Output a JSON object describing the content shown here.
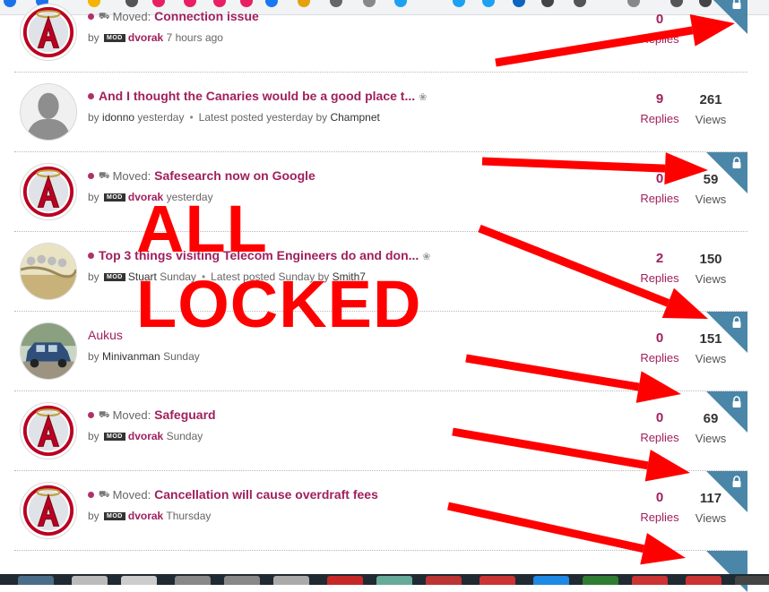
{
  "colors": {
    "accent": "#a0205e",
    "lock_corner": "#4a86a8",
    "annotation_red": "#ff0000"
  },
  "labels": {
    "replies": "Replies",
    "views": "Views",
    "moved_prefix": "Moved:",
    "by": "by",
    "mod_badge": "MOD",
    "latest_prefix": "Latest posted",
    "latest_by": "by"
  },
  "annotation": {
    "line1": "ALL",
    "line2": "LOCKED"
  },
  "topics": [
    {
      "moved": true,
      "title": "Connection issue",
      "author": "dvorak",
      "mod": true,
      "time": "7 hours ago",
      "replies": "0",
      "views": "",
      "locked": true,
      "avatar": "angels-logo-icon"
    },
    {
      "moved": false,
      "title": "And I thought the Canaries would be a good place t...",
      "author": "idonno",
      "mod": false,
      "time": "yesterday",
      "latest_time": "yesterday",
      "latest_author": "Champnet",
      "replies": "9",
      "views": "261",
      "locked": false,
      "avatar": "default-user-silhouette-icon"
    },
    {
      "moved": true,
      "title": "Safesearch now on Google",
      "author": "dvorak",
      "mod": true,
      "time": "yesterday",
      "replies": "0",
      "views": "59",
      "locked": true,
      "avatar": "angels-logo-icon"
    },
    {
      "moved": false,
      "title": "Top 3 things visiting Telecom Engineers do and don...",
      "author": "Stuart",
      "mod": true,
      "time": "Sunday",
      "latest_time": "Sunday",
      "latest_author": "Smith7",
      "replies": "2",
      "views": "150",
      "locked": false,
      "avatar": "cable-photo-icon"
    },
    {
      "moved": false,
      "title": "Aukus",
      "author": "Minivanman",
      "mod": false,
      "time": "Sunday",
      "replies": "0",
      "views": "151",
      "locked": true,
      "avatar": "blue-car-photo-icon"
    },
    {
      "moved": true,
      "title": "Safeguard",
      "author": "dvorak",
      "mod": true,
      "time": "Sunday",
      "replies": "0",
      "views": "69",
      "locked": true,
      "avatar": "angels-logo-icon"
    },
    {
      "moved": true,
      "title": "Cancellation will cause overdraft fees",
      "author": "dvorak",
      "mod": true,
      "time": "Thursday",
      "replies": "0",
      "views": "117",
      "locked": true,
      "avatar": "angels-logo-icon"
    }
  ]
}
